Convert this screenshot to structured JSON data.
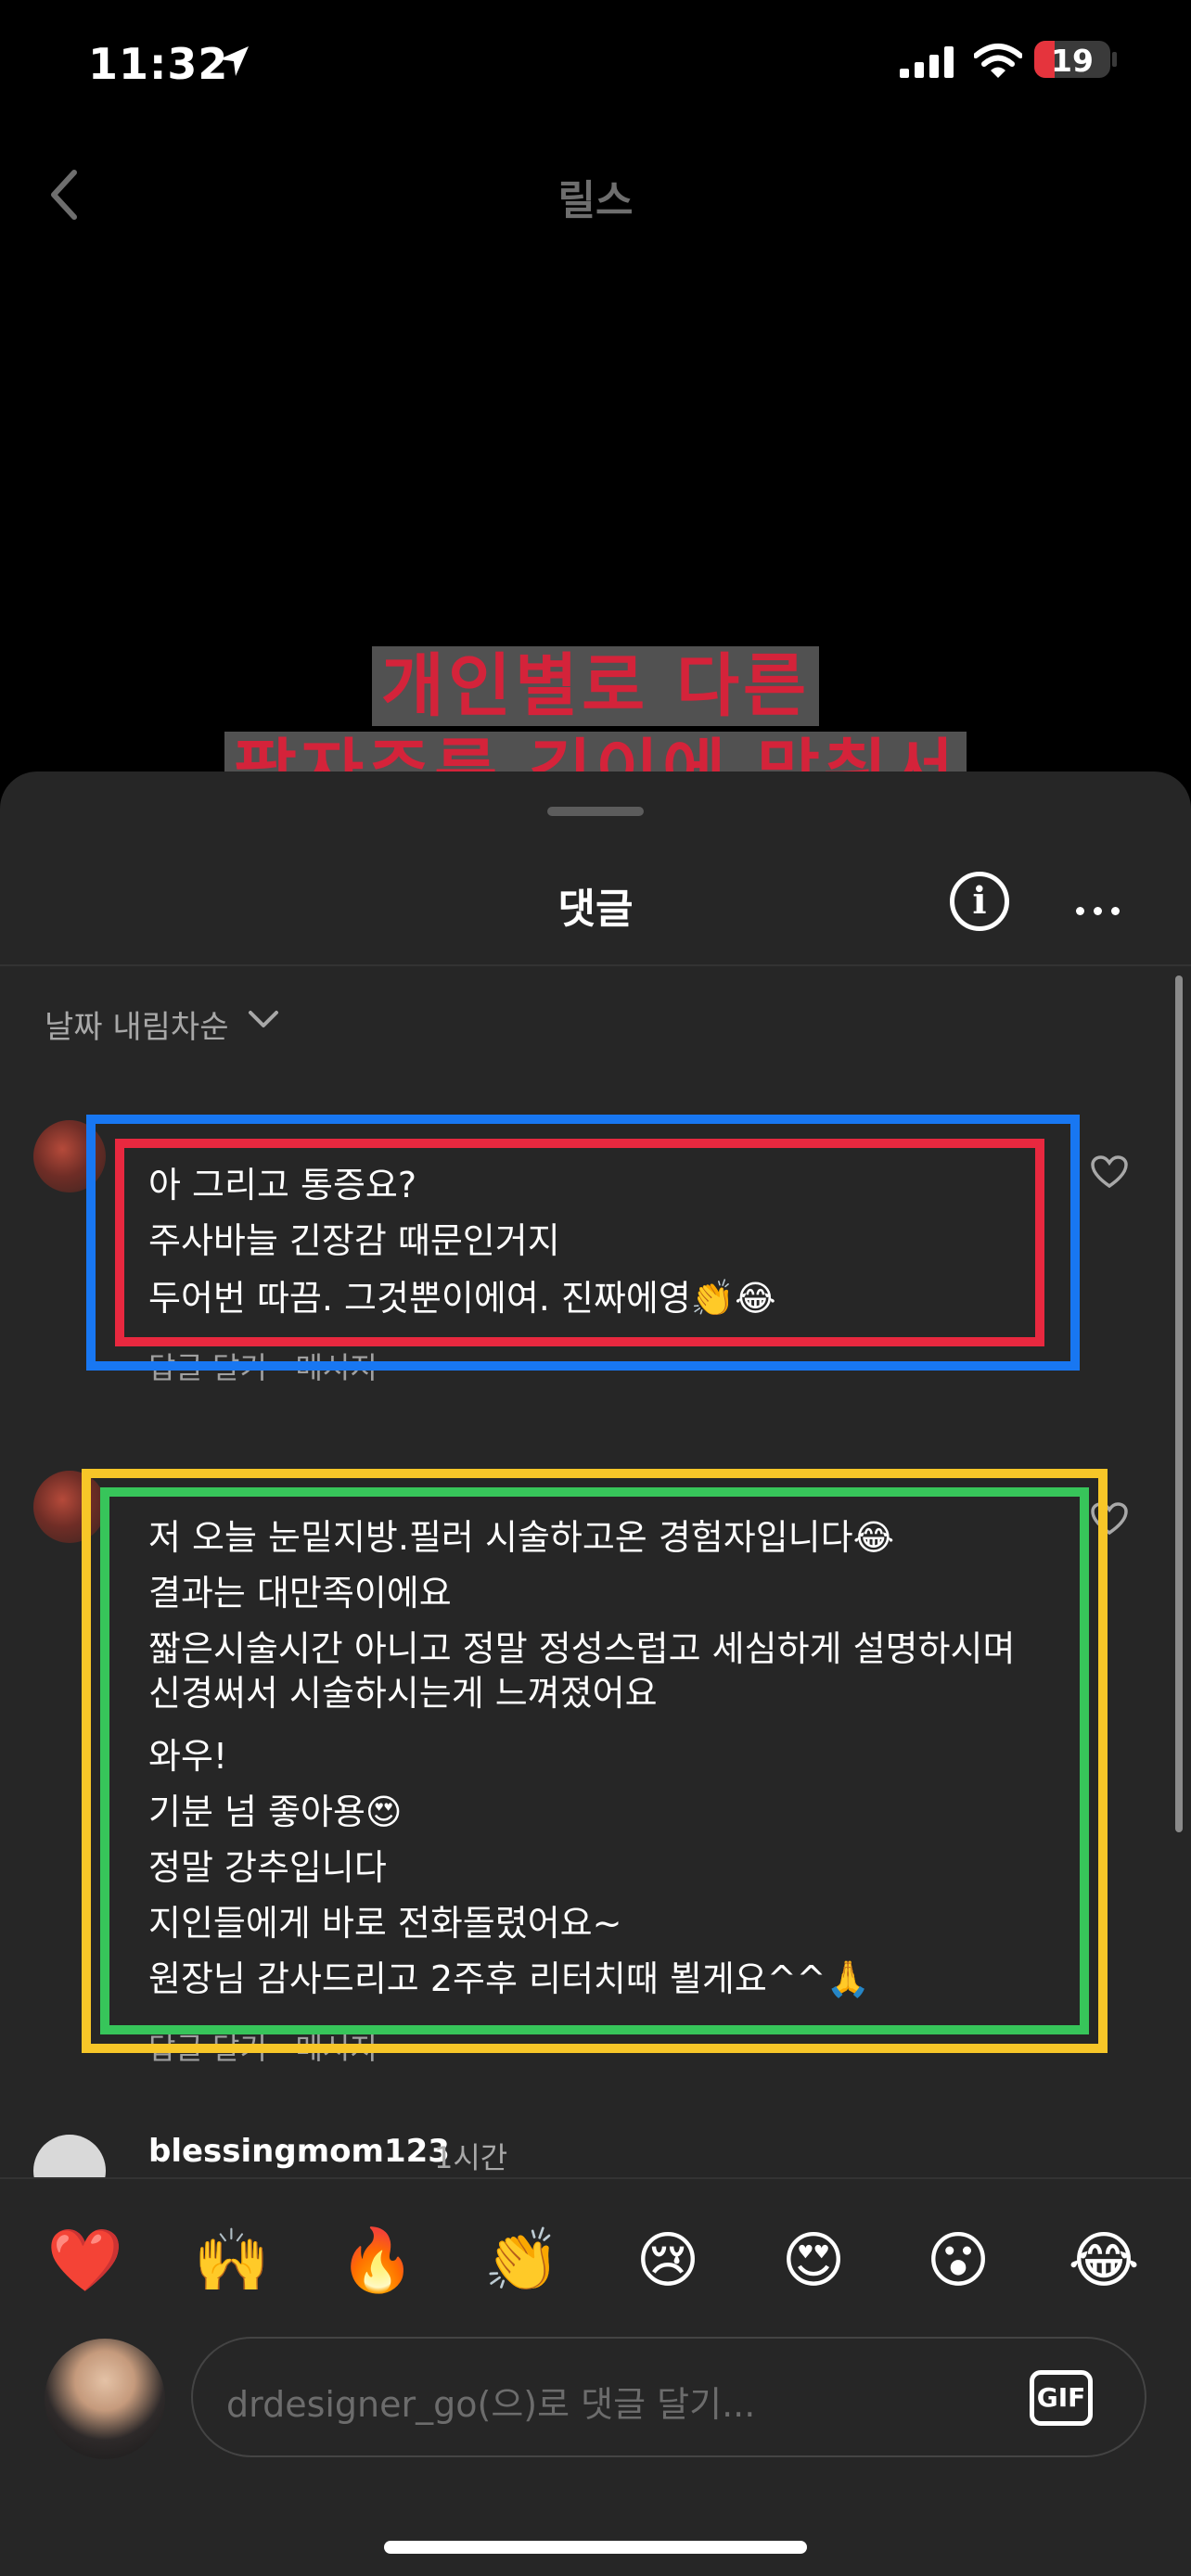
{
  "status_bar": {
    "time": "11:32",
    "battery": "19"
  },
  "header": {
    "title": "릴스"
  },
  "video_caption": {
    "line1": "개인별로 다른",
    "line2": "팔자주름 깊이에 맞춰서"
  },
  "sheet": {
    "title": "댓글",
    "sort_label": "날짜 내림차순"
  },
  "comments": [
    {
      "lines": [
        "아 그리고 통증요?",
        "주사바늘 긴장감 때문인거지",
        "두어번 따끔. 그것뿐이에여. 진짜에영👏😂"
      ],
      "reply_hint": "답글 달기 · 메시지"
    },
    {
      "lines": [
        "저 오늘 눈밑지방.필러 시술하고온 경험자입니다😂",
        "결과는 대만족이에요",
        "짧은시술시간 아니고 정말 정성스럽고 세심하게 설명하시며 신경써서 시술하시는게 느껴졌어요",
        "와우!",
        "기분 넘 좋아용😍",
        "정말 강추입니다",
        "지인들에게 바로 전화돌렸어요~",
        "원장님 감사드리고 2주후 리터치때 뵐게요^^🙏"
      ],
      "reply_hint": "답글 달기 · 메시지"
    },
    {
      "username": "blessingmom123",
      "time": "1시간"
    }
  ],
  "emoji_bar": [
    "❤️",
    "🙌",
    "🔥",
    "👏",
    "😢",
    "😍",
    "😮",
    "😂"
  ],
  "input": {
    "placeholder": "drdesigner_go(으)로 댓글 달기...",
    "gif_label": "GIF"
  },
  "annotation_colors": {
    "blue": "#1877f2",
    "red": "#e8283f",
    "yellow": "#f7c628",
    "green": "#37c55a"
  }
}
